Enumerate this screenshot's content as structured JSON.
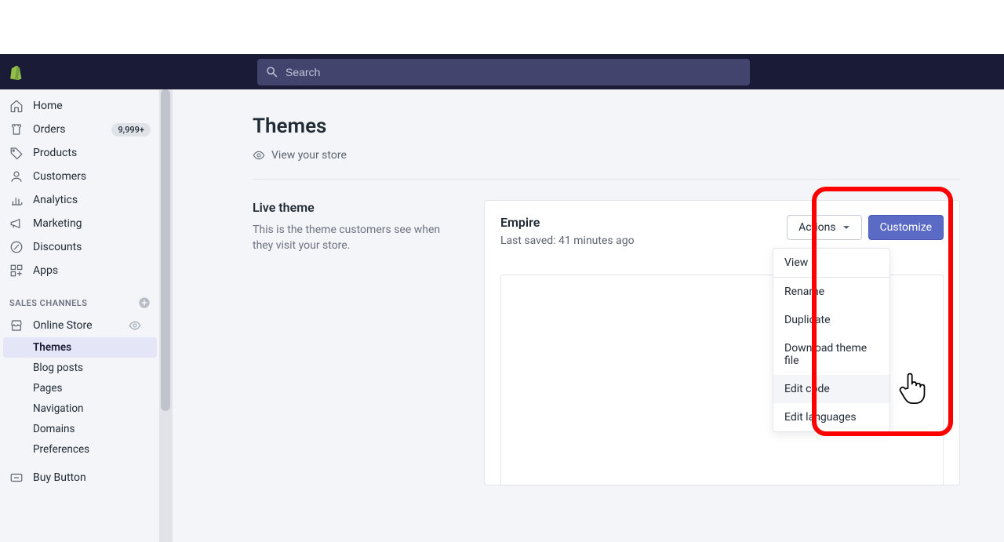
{
  "search": {
    "placeholder": "Search"
  },
  "sidebar": {
    "items": [
      {
        "label": "Home"
      },
      {
        "label": "Orders",
        "badge": "9,999+"
      },
      {
        "label": "Products"
      },
      {
        "label": "Customers"
      },
      {
        "label": "Analytics"
      },
      {
        "label": "Marketing"
      },
      {
        "label": "Discounts"
      },
      {
        "label": "Apps"
      }
    ],
    "channels_title": "SALES CHANNELS",
    "channels": [
      {
        "label": "Online Store"
      },
      {
        "label": "Buy Button"
      }
    ],
    "online_store_sub": [
      {
        "label": "Themes",
        "selected": true
      },
      {
        "label": "Blog posts"
      },
      {
        "label": "Pages"
      },
      {
        "label": "Navigation"
      },
      {
        "label": "Domains"
      },
      {
        "label": "Preferences"
      }
    ]
  },
  "page": {
    "title": "Themes",
    "view_store": "View your store",
    "live_theme": {
      "title": "Live theme",
      "desc": "This is the theme customers see when they visit your store."
    }
  },
  "card": {
    "theme_name": "Empire",
    "last_saved": "Last saved: 41 minutes ago",
    "actions_label": "Actions",
    "customize_label": "Customize"
  },
  "dropdown": {
    "items": [
      {
        "label": "View"
      },
      {
        "label": "Rename"
      },
      {
        "label": "Duplicate"
      },
      {
        "label": "Download theme file"
      },
      {
        "label": "Edit code",
        "hovered": true
      },
      {
        "label": "Edit languages"
      }
    ]
  }
}
